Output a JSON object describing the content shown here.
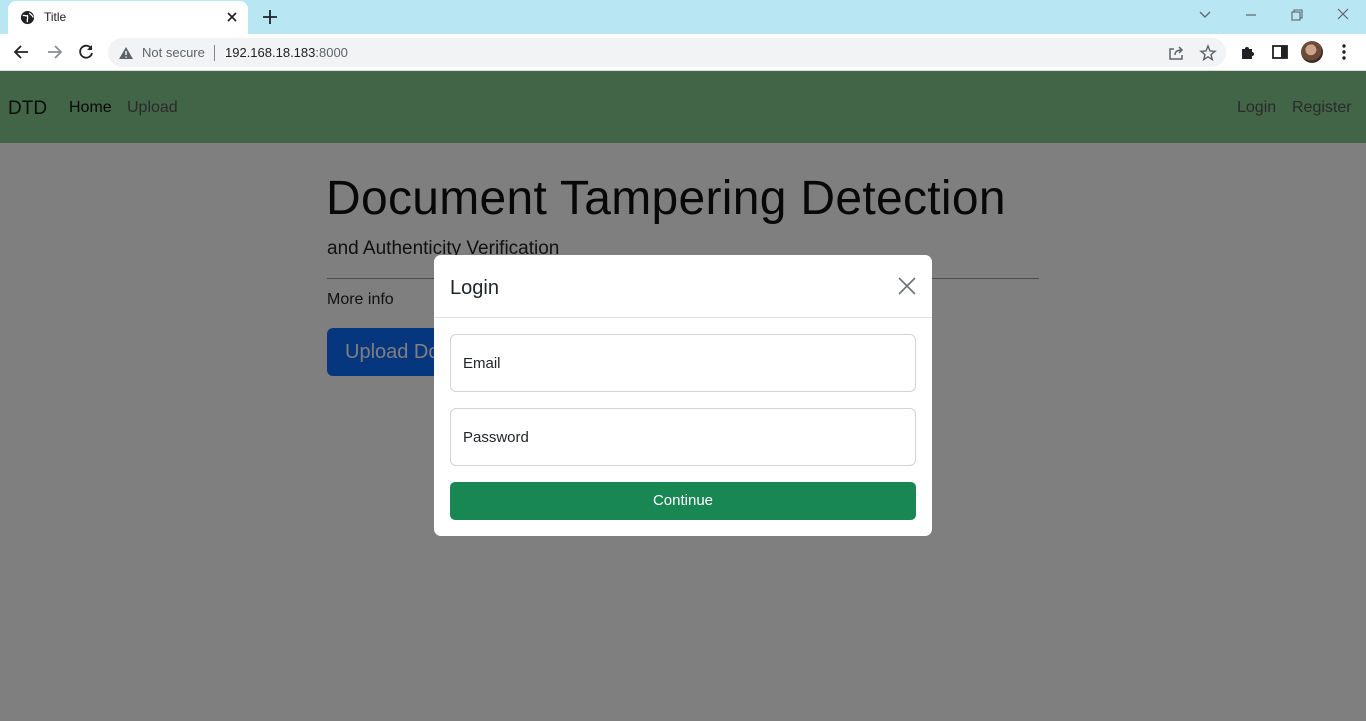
{
  "browser": {
    "tab_title": "Title",
    "omnibox": {
      "security_label": "Not secure",
      "url_host": "192.168.18.183",
      "url_port": ":8000"
    }
  },
  "navbar": {
    "brand": "DTD",
    "left_links": [
      "Home",
      "Upload"
    ],
    "right_links": [
      "Login",
      "Register"
    ],
    "background_color": "#84c98f"
  },
  "hero": {
    "title": "Document Tampering Detection",
    "subtitle": "and Authenticity Verification",
    "more_info": "More info",
    "upload_button": "Upload Do"
  },
  "modal": {
    "title": "Login",
    "email_placeholder": "Email",
    "password_placeholder": "Password",
    "continue_label": "Continue",
    "continue_color": "#198754"
  },
  "icons": [
    "globe-icon",
    "close-icon",
    "plus-icon",
    "back-icon",
    "forward-icon",
    "reload-icon",
    "warning-icon",
    "share-icon",
    "star-icon",
    "puzzle-icon",
    "sidepanel-icon",
    "kebab-menu-icon"
  ]
}
